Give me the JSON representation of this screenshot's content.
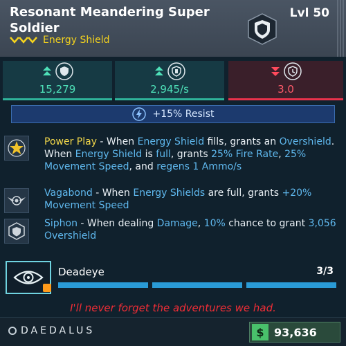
{
  "header": {
    "title": "Resonant Meandering Super Soldier",
    "subtype": "Energy Shield",
    "level": "Lvl 50"
  },
  "stats": [
    {
      "value": "15,279",
      "trend": "up",
      "icon": "shield-capacity-icon"
    },
    {
      "value": "2,945/s",
      "trend": "up",
      "icon": "shield-recharge-icon"
    },
    {
      "value": "3.0",
      "trend": "down",
      "icon": "shield-delay-icon"
    }
  ],
  "resist": {
    "icon": "lightning-icon",
    "label": "+15% Resist"
  },
  "perks": [
    {
      "name": "Power Play",
      "icon": "star-icon",
      "parts": [
        " - When ",
        "Energy Shield",
        " fills, grants an ",
        "Overshield",
        ". When ",
        "Energy Shield",
        " is ",
        "full",
        ", grants ",
        "25% Fire Rate",
        ", ",
        "25% Movement Speed",
        ", and ",
        "regens 1 Ammo/s"
      ]
    },
    {
      "name": "Vagabond",
      "icon": "winged-emblem-icon",
      "parts": [
        " - When ",
        "Energy Shields",
        " are full, grants ",
        "+20% Movement Speed"
      ]
    },
    {
      "name": "Siphon",
      "icon": "shield-badge-icon",
      "parts": [
        " - When dealing ",
        "Damage",
        ", ",
        "10%",
        " chance to grant ",
        "3,056 Overshield"
      ]
    }
  ],
  "ability": {
    "name": "Deadeye",
    "count": "3/3",
    "icon": "eye-target-icon"
  },
  "quote": "I'll never forget the adventures we had.",
  "footer": {
    "brand": "DAEDALUS",
    "currency_icon": "$",
    "price": "93,636"
  },
  "colors": {
    "highlight": "#5fb8ee",
    "perk_name": "#f3d84a",
    "quote": "#ef2d36",
    "up": "#2fb39a",
    "down": "#e8324b"
  }
}
